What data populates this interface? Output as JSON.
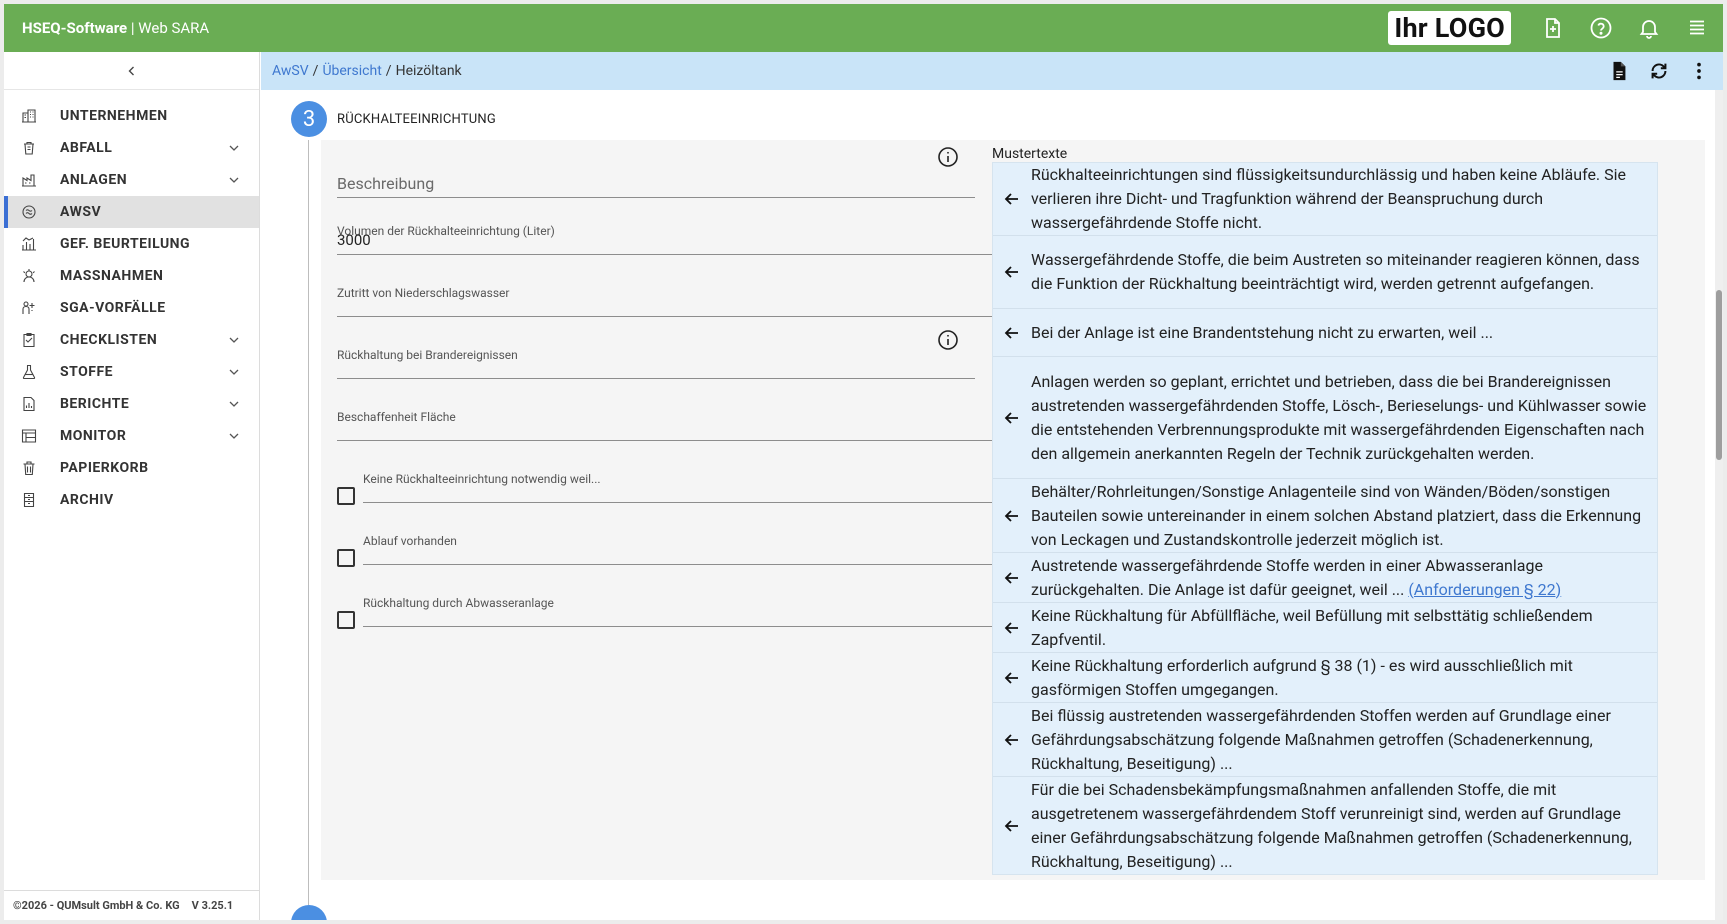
{
  "app": {
    "brand_bold": "HSEQ-Software",
    "brand_sep": " | ",
    "brand_rest": "Web SARA",
    "logo_text": "Ihr LOGO",
    "accent": "#6aad54",
    "link_color": "#3f78cf"
  },
  "topbar_icons": [
    "document-icon",
    "help-icon",
    "bell-icon",
    "menu-icon"
  ],
  "sidebar": {
    "items": [
      {
        "label": "UNTERNEHMEN",
        "icon": "company-icon",
        "has_children": false,
        "active": false
      },
      {
        "label": "ABFALL",
        "icon": "waste-icon",
        "has_children": true,
        "active": false
      },
      {
        "label": "ANLAGEN",
        "icon": "plant-icon",
        "has_children": true,
        "active": false
      },
      {
        "label": "AWSV",
        "icon": "water-icon",
        "has_children": false,
        "active": true
      },
      {
        "label": "GEF. BEURTEILUNG",
        "icon": "risk-chart-icon",
        "has_children": false,
        "active": false
      },
      {
        "label": "MASSNAHMEN",
        "icon": "measures-icon",
        "has_children": false,
        "active": false
      },
      {
        "label": "SGA-VORFÄLLE",
        "icon": "incident-icon",
        "has_children": false,
        "active": false
      },
      {
        "label": "CHECKLISTEN",
        "icon": "checklist-icon",
        "has_children": true,
        "active": false
      },
      {
        "label": "STOFFE",
        "icon": "flask-icon",
        "has_children": true,
        "active": false
      },
      {
        "label": "BERICHTE",
        "icon": "report-icon",
        "has_children": true,
        "active": false
      },
      {
        "label": "MONITOR",
        "icon": "monitor-icon",
        "has_children": true,
        "active": false
      },
      {
        "label": "PAPIERKORB",
        "icon": "trash-icon",
        "has_children": false,
        "active": false
      },
      {
        "label": "ARCHIV",
        "icon": "archive-icon",
        "has_children": false,
        "active": false
      }
    ],
    "footer_copyright": "©2026 - QUMsult GmbH & Co. KG",
    "footer_version": "V 3.25.1"
  },
  "breadcrumb": {
    "items": [
      "AwSV",
      "Übersicht"
    ],
    "current": "Heizöltank",
    "separator": "/"
  },
  "section": {
    "step_number": "3",
    "title": "RÜCKHALTEEINRICHTUNG"
  },
  "form": {
    "beschreibung_label": "Beschreibung",
    "volumen_label": "Volumen der Rückhalteeinrichtung (Liter)",
    "volumen_value": "3000",
    "zutritt_label": "Zutritt von Niederschlagswasser",
    "brand_label": "Rückhaltung bei Brandereignissen",
    "flaeche_label": "Beschaffenheit Fläche",
    "keine_label": "Keine Rückhalteeinrichtung notwendig weil...",
    "ablauf_label": "Ablauf vorhanden",
    "abwasser_label": "Rückhaltung durch Abwasseranlage"
  },
  "mustertexte": {
    "title": "Mustertexte",
    "items": [
      {
        "text": "Rückhalteeinrichtungen sind flüssigkeitsundurchlässig und haben keine Abläufe. Sie verlieren ihre Dicht- und Tragfunktion während der Beanspruchung durch wassergefährdende Stoffe nicht.",
        "link": ""
      },
      {
        "text": "Wassergefährdende Stoffe, die beim Austreten so miteinander reagieren können, dass die Funktion der Rückhaltung beeinträchtigt wird, werden getrennt aufgefangen.",
        "link": ""
      },
      {
        "text": "Bei der Anlage ist eine Brandentstehung nicht zu erwarten, weil ...",
        "link": ""
      },
      {
        "text": "Anlagen werden so geplant, errichtet und betrieben, dass die bei Brandereignissen austretenden wassergefährdenden Stoffe, Lösch-, Berieselungs- und Kühlwasser sowie die entstehenden Verbrennungsprodukte mit wassergefährdenden Eigenschaften nach den allgemein anerkannten Regeln der Technik zurückgehalten werden.",
        "link": ""
      },
      {
        "text": "Behälter/Rohrleitungen/Sonstige Anlagenteile sind von Wänden/Böden/sonstigen Bauteilen sowie untereinander in einem solchen Abstand platziert, dass die Erkennung von Leckagen und Zustandskontrolle jederzeit möglich ist.",
        "link": ""
      },
      {
        "text": "Austretende wassergefährdende Stoffe werden in einer Abwasseranlage zurückgehalten. Die Anlage ist dafür geeignet, weil ... ",
        "link": "(Anforderungen § 22)"
      },
      {
        "text": "Keine Rückhaltung für Abfüllfläche, weil Befüllung mit selbsttätig schließendem Zapfventil.",
        "link": ""
      },
      {
        "text": "Keine Rückhaltung erforderlich aufgrund § 38 (1) - es wird ausschließlich mit gasförmigen Stoffen umgegangen.",
        "link": ""
      },
      {
        "text": "Bei flüssig austretenden wassergefährdenden Stoffen werden auf Grundlage einer Gefährdungsabschätzung folgende Maßnahmen getroffen (Schadenerkennung, Rückhaltung, Beseitigung) ...",
        "link": ""
      },
      {
        "text": "Für die bei Schadensbekämpfungsmaßnahmen anfallenden Stoffe, die mit ausgetretenem wassergefährdendem Stoff verunreinigt sind, werden auf Grundlage einer Gefährdungsabschätzung folgende Maßnahmen getroffen (Schadenerkennung, Rückhaltung, Beseitigung) ...",
        "link": ""
      }
    ]
  }
}
